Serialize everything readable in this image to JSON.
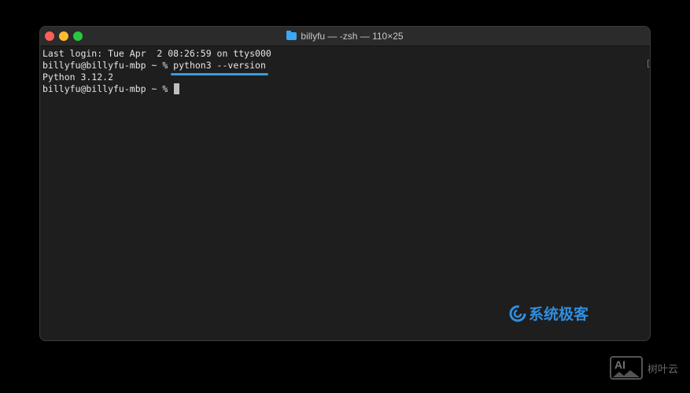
{
  "window": {
    "title": "billyfu — -zsh — 110×25",
    "title_icon": "folder-icon",
    "buttons": {
      "close_color": "#fe5f57",
      "minimize_color": "#febc2e",
      "maximize_color": "#28c840"
    }
  },
  "terminal": {
    "lines": [
      "Last login: Tue Apr  2 08:26:59 on ttys000",
      "billyfu@billyfu-mbp ~ % ",
      "Python 3.12.2",
      "billyfu@billyfu-mbp ~ % "
    ],
    "command": "python3 --version",
    "highlight_color": "#3a9be0",
    "cursor_color": "#bfbfbf",
    "folder_color": "#3da7f0"
  },
  "watermark": {
    "text": "系统极客",
    "color": "#2f8fe0",
    "icon": "swirl-logo-icon"
  },
  "corner_mark": {
    "badge": "AI",
    "text": "树叶云",
    "icon": "image-mountain-icon"
  }
}
